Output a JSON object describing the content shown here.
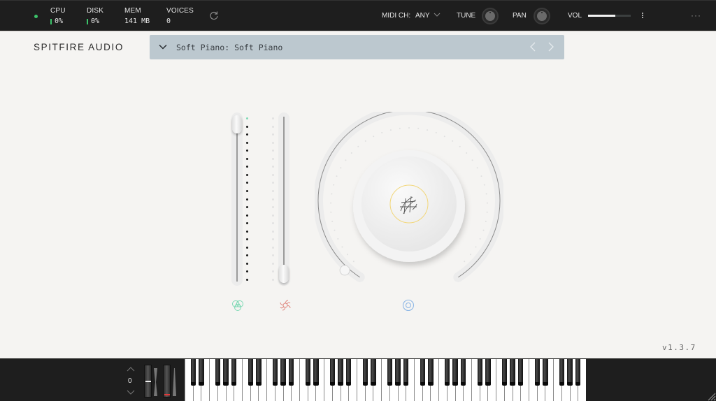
{
  "topbar": {
    "stats": [
      {
        "label": "CPU",
        "value": "0%",
        "meter": true
      },
      {
        "label": "DISK",
        "value": "0%",
        "meter": true
      },
      {
        "label": "MEM",
        "value": "141 MB",
        "meter": false
      },
      {
        "label": "VOICES",
        "value": "0",
        "meter": false
      }
    ],
    "refresh_icon": "refresh-icon",
    "midi_label": "MIDI CH:",
    "midi_value": "ANY",
    "tune_label": "TUNE",
    "pan_label": "PAN",
    "vol_label": "VOL",
    "vol_level": 0.64,
    "more_label": "···",
    "status_color": "#3cc46a"
  },
  "header": {
    "brand": "SPITFIRE AUDIO",
    "preset_name": "Soft Piano: Soft Piano"
  },
  "controls": {
    "slider_left_level": 1.0,
    "slider_right_level": 0.0,
    "main_knob_level": 0.0,
    "icons": [
      {
        "name": "dynamics-icon",
        "color": "#7fd9b5"
      },
      {
        "name": "reverb-icon",
        "color": "#e08a82"
      },
      {
        "name": "target-icon",
        "color": "#8fb8e6"
      }
    ],
    "knob_center_ring_color": "#f2d77a"
  },
  "footer": {
    "version": "v1.3.7",
    "octave_value": "0"
  },
  "keyboard": {
    "octaves": 7,
    "start_note": "C"
  }
}
